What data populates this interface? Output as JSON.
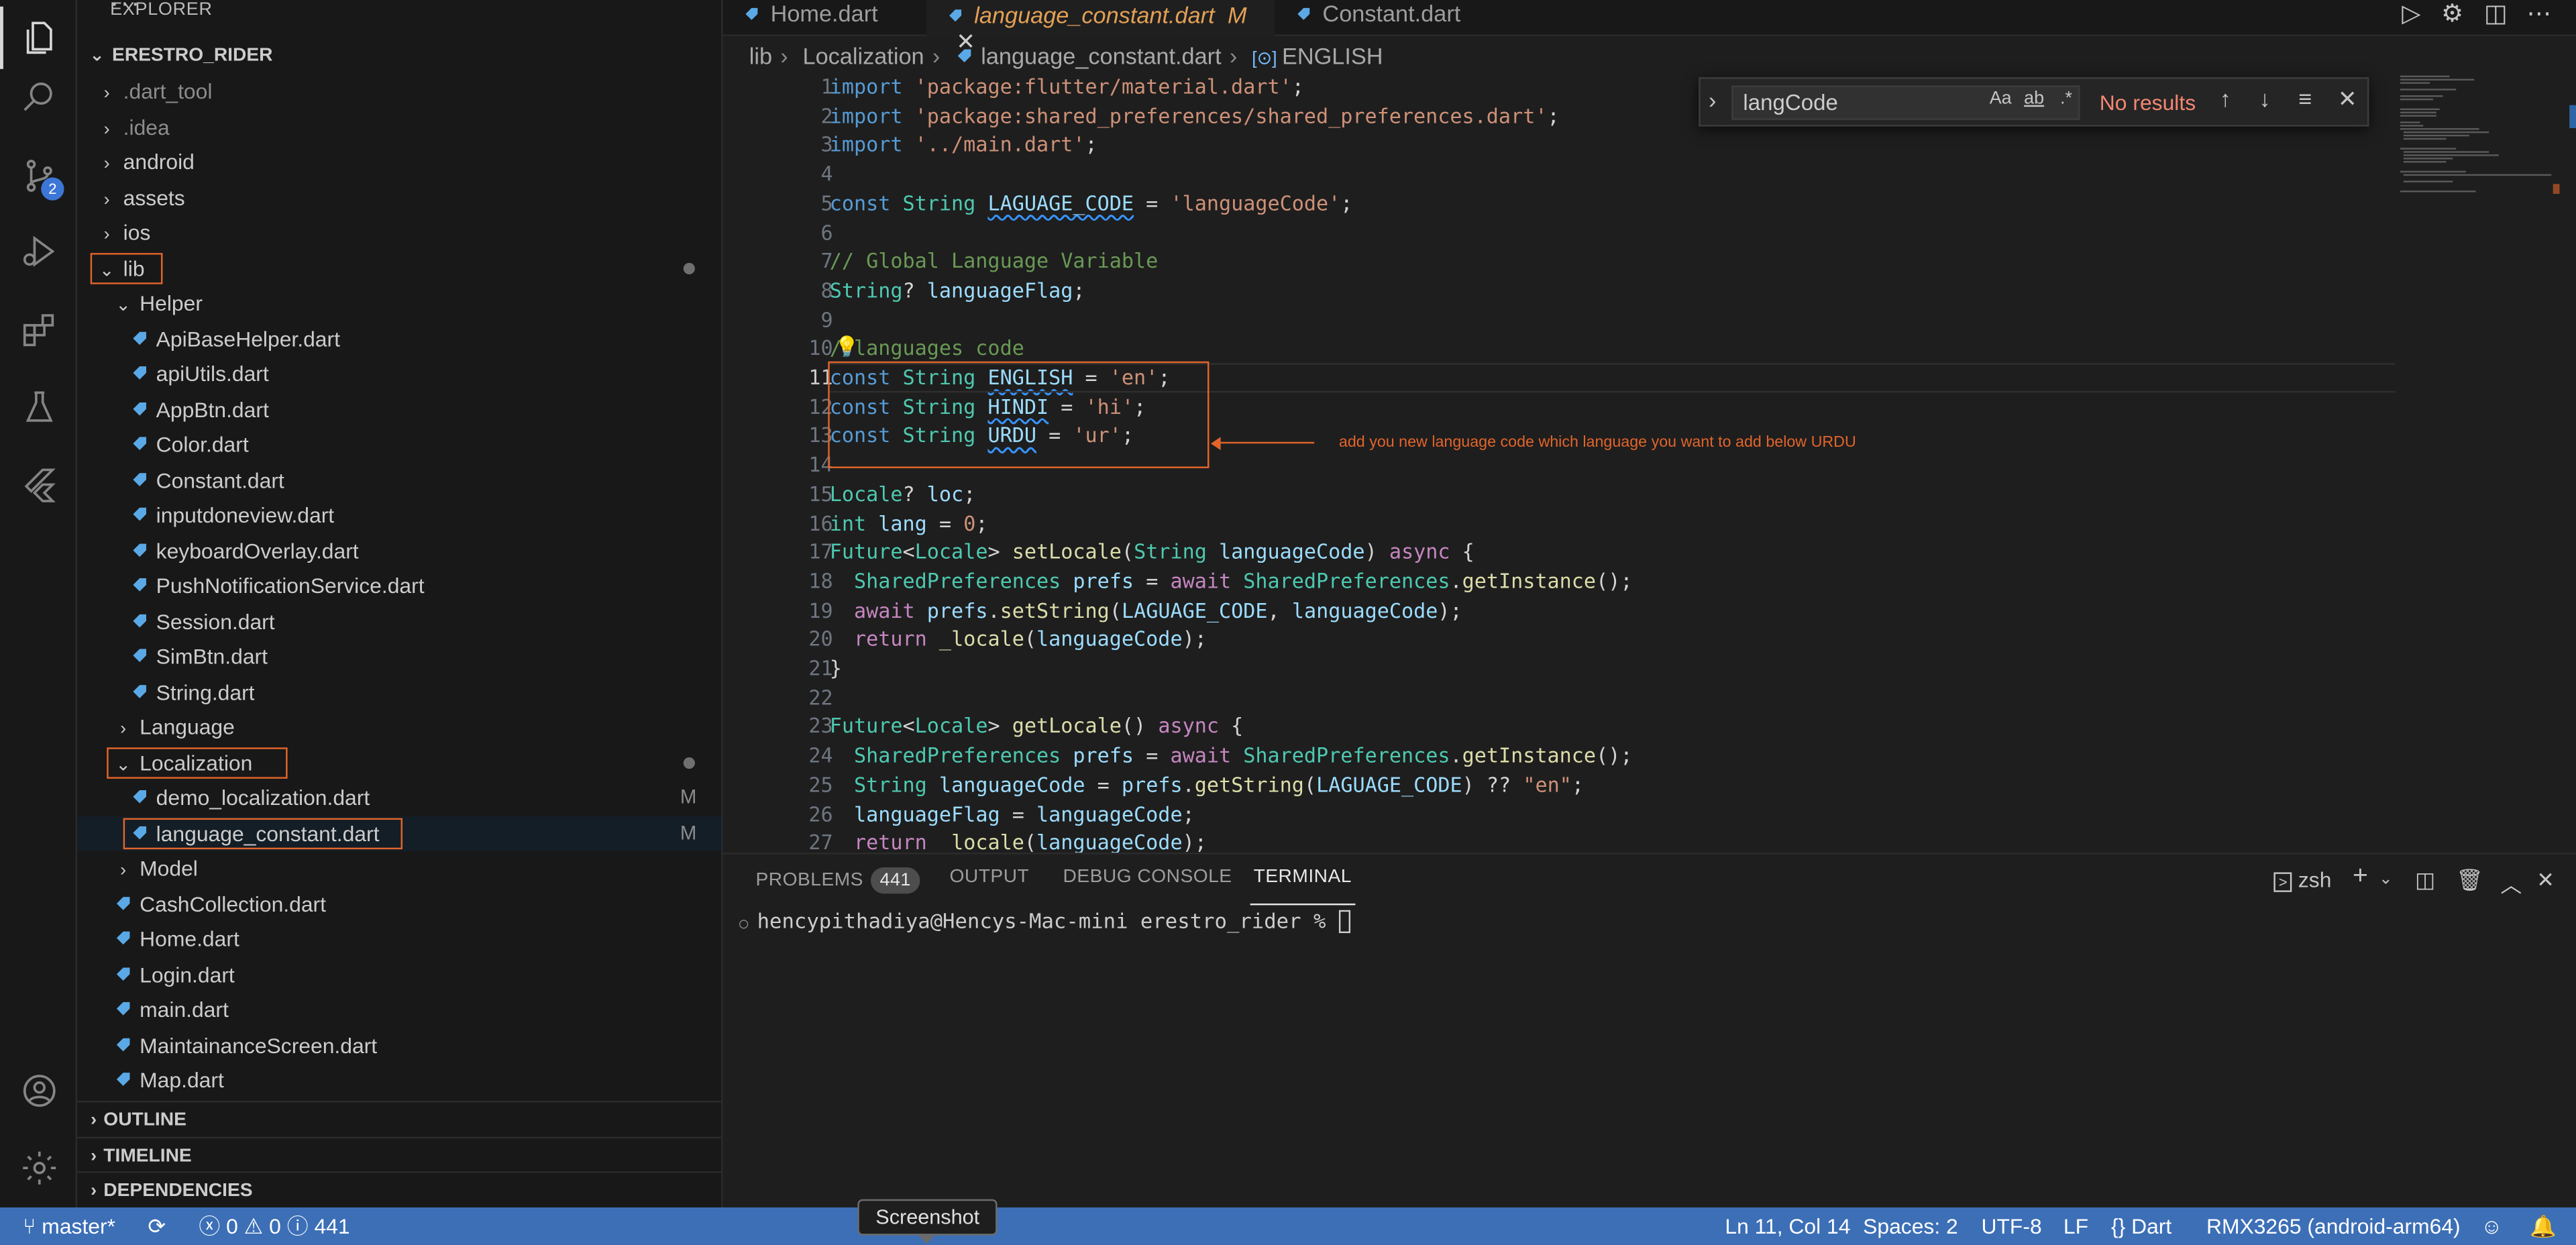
{
  "explorer": {
    "title": "EXPLORER",
    "root": "ERESTRO_RIDER",
    "items": [
      {
        "label": ".dart_tool",
        "kind": "folder",
        "depth": 1,
        "dim": true
      },
      {
        "label": ".idea",
        "kind": "folder",
        "depth": 1,
        "dim": true
      },
      {
        "label": "android",
        "kind": "folder",
        "depth": 1
      },
      {
        "label": "assets",
        "kind": "folder",
        "depth": 1
      },
      {
        "label": "ios",
        "kind": "folder",
        "depth": 1
      },
      {
        "label": "lib",
        "kind": "folder-open",
        "depth": 1,
        "dot": true,
        "boxed": true
      },
      {
        "label": "Helper",
        "kind": "folder-open",
        "depth": 2
      },
      {
        "label": "ApiBaseHelper.dart",
        "kind": "file",
        "depth": 3
      },
      {
        "label": "apiUtils.dart",
        "kind": "file",
        "depth": 3
      },
      {
        "label": "AppBtn.dart",
        "kind": "file",
        "depth": 3
      },
      {
        "label": "Color.dart",
        "kind": "file",
        "depth": 3
      },
      {
        "label": "Constant.dart",
        "kind": "file",
        "depth": 3
      },
      {
        "label": "inputdoneview.dart",
        "kind": "file",
        "depth": 3
      },
      {
        "label": "keyboardOverlay.dart",
        "kind": "file",
        "depth": 3
      },
      {
        "label": "PushNotificationService.dart",
        "kind": "file",
        "depth": 3
      },
      {
        "label": "Session.dart",
        "kind": "file",
        "depth": 3
      },
      {
        "label": "SimBtn.dart",
        "kind": "file",
        "depth": 3
      },
      {
        "label": "String.dart",
        "kind": "file",
        "depth": 3
      },
      {
        "label": "Language",
        "kind": "folder",
        "depth": 2
      },
      {
        "label": "Localization",
        "kind": "folder-open",
        "depth": 2,
        "dot": true,
        "boxed": true
      },
      {
        "label": "demo_localization.dart",
        "kind": "file",
        "depth": 3,
        "mod": "M"
      },
      {
        "label": "language_constant.dart",
        "kind": "file",
        "depth": 3,
        "mod": "M",
        "selected": true,
        "boxed": true
      },
      {
        "label": "Model",
        "kind": "folder",
        "depth": 2
      },
      {
        "label": "CashCollection.dart",
        "kind": "file",
        "depth": 2
      },
      {
        "label": "Home.dart",
        "kind": "file",
        "depth": 2
      },
      {
        "label": "Login.dart",
        "kind": "file",
        "depth": 2
      },
      {
        "label": "main.dart",
        "kind": "file",
        "depth": 2
      },
      {
        "label": "MaintainanceScreen.dart",
        "kind": "file",
        "depth": 2
      },
      {
        "label": "Map.dart",
        "kind": "file",
        "depth": 2
      }
    ],
    "sections": [
      "OUTLINE",
      "TIMELINE",
      "DEPENDENCIES"
    ]
  },
  "activity": {
    "scm_badge": "2"
  },
  "tabs": [
    {
      "label": "Home.dart",
      "modified": ""
    },
    {
      "label": "language_constant.dart",
      "modified": "M",
      "active": true
    },
    {
      "label": "Constant.dart",
      "modified": ""
    }
  ],
  "breadcrumb": [
    "lib",
    "Localization",
    "language_constant.dart",
    "ENGLISH"
  ],
  "find": {
    "query": "langCode",
    "result": "No results",
    "opt_case": "Aa",
    "opt_word": "ab",
    "opt_regex": ".*"
  },
  "editor": {
    "current_line": 11,
    "lines": [
      [
        [
          "kw",
          "import "
        ],
        [
          "st",
          "'package:flutter/material.dart'"
        ],
        [
          "pl",
          ";"
        ]
      ],
      [
        [
          "kw",
          "import "
        ],
        [
          "st",
          "'package:shared_preferences/shared_preferences.dart'"
        ],
        [
          "pl",
          ";"
        ]
      ],
      [
        [
          "kw",
          "import "
        ],
        [
          "st",
          "'../main.dart'"
        ],
        [
          "pl",
          ";"
        ]
      ],
      [],
      [
        [
          "kw",
          "const "
        ],
        [
          "ty",
          "String "
        ],
        [
          "squig",
          "LAGUAGE_CODE"
        ],
        [
          "pl",
          " = "
        ],
        [
          "st",
          "'languageCode'"
        ],
        [
          "pl",
          ";"
        ]
      ],
      [],
      [
        [
          "cm",
          "// Global Language Variable"
        ]
      ],
      [
        [
          "ty",
          "String"
        ],
        [
          "pl",
          "? "
        ],
        [
          "va",
          "languageFlag"
        ],
        [
          "pl",
          ";"
        ]
      ],
      [],
      [
        [
          "cm",
          "//languages code"
        ]
      ],
      [
        [
          "kw",
          "const "
        ],
        [
          "ty",
          "String "
        ],
        [
          "squig",
          "ENGLISH"
        ],
        [
          "pl",
          " = "
        ],
        [
          "st",
          "'en'"
        ],
        [
          "pl",
          ";"
        ]
      ],
      [
        [
          "kw",
          "const "
        ],
        [
          "ty",
          "String "
        ],
        [
          "squig",
          "HINDI"
        ],
        [
          "pl",
          " = "
        ],
        [
          "st",
          "'hi'"
        ],
        [
          "pl",
          ";"
        ]
      ],
      [
        [
          "kw",
          "const "
        ],
        [
          "ty",
          "String "
        ],
        [
          "squig",
          "URDU"
        ],
        [
          "pl",
          " = "
        ],
        [
          "st",
          "'ur'"
        ],
        [
          "pl",
          ";"
        ]
      ],
      [],
      [
        [
          "ty",
          "Locale"
        ],
        [
          "pl",
          "? "
        ],
        [
          "va",
          "loc"
        ],
        [
          "pl",
          ";"
        ]
      ],
      [
        [
          "ty",
          "int "
        ],
        [
          "va",
          "lang"
        ],
        [
          "pl",
          " = "
        ],
        [
          "st",
          "0"
        ],
        [
          "pl",
          ";"
        ]
      ],
      [
        [
          "ty",
          "Future"
        ],
        [
          "pl",
          "<"
        ],
        [
          "ty",
          "Locale"
        ],
        [
          "pl",
          "> "
        ],
        [
          "fn",
          "setLocale"
        ],
        [
          "pl",
          "("
        ],
        [
          "ty",
          "String "
        ],
        [
          "va",
          "languageCode"
        ],
        [
          "pl",
          ") "
        ],
        [
          "ct",
          "async"
        ],
        [
          "pl",
          " {"
        ]
      ],
      [
        [
          "pl",
          "  "
        ],
        [
          "ty",
          "SharedPreferences "
        ],
        [
          "va",
          "prefs"
        ],
        [
          "pl",
          " = "
        ],
        [
          "ct",
          "await "
        ],
        [
          "ty",
          "SharedPreferences"
        ],
        [
          "pl",
          "."
        ],
        [
          "fn",
          "getInstance"
        ],
        [
          "pl",
          "();"
        ]
      ],
      [
        [
          "pl",
          "  "
        ],
        [
          "ct",
          "await "
        ],
        [
          "va",
          "prefs"
        ],
        [
          "pl",
          "."
        ],
        [
          "fn",
          "setString"
        ],
        [
          "pl",
          "("
        ],
        [
          "va",
          "LAGUAGE_CODE"
        ],
        [
          "pl",
          ", "
        ],
        [
          "va",
          "languageCode"
        ],
        [
          "pl",
          ");"
        ]
      ],
      [
        [
          "pl",
          "  "
        ],
        [
          "ct",
          "return "
        ],
        [
          "fn",
          "_locale"
        ],
        [
          "pl",
          "("
        ],
        [
          "va",
          "languageCode"
        ],
        [
          "pl",
          ");"
        ]
      ],
      [
        [
          "pl",
          "}"
        ]
      ],
      [],
      [
        [
          "ty",
          "Future"
        ],
        [
          "pl",
          "<"
        ],
        [
          "ty",
          "Locale"
        ],
        [
          "pl",
          "> "
        ],
        [
          "fn",
          "getLocale"
        ],
        [
          "pl",
          "() "
        ],
        [
          "ct",
          "async"
        ],
        [
          "pl",
          " {"
        ]
      ],
      [
        [
          "pl",
          "  "
        ],
        [
          "ty",
          "SharedPreferences "
        ],
        [
          "va",
          "prefs"
        ],
        [
          "pl",
          " = "
        ],
        [
          "ct",
          "await "
        ],
        [
          "ty",
          "SharedPreferences"
        ],
        [
          "pl",
          "."
        ],
        [
          "fn",
          "getInstance"
        ],
        [
          "pl",
          "();"
        ]
      ],
      [
        [
          "pl",
          "  "
        ],
        [
          "ty",
          "String "
        ],
        [
          "va",
          "languageCode"
        ],
        [
          "pl",
          " = "
        ],
        [
          "va",
          "prefs"
        ],
        [
          "pl",
          "."
        ],
        [
          "fn",
          "getString"
        ],
        [
          "pl",
          "("
        ],
        [
          "va",
          "LAGUAGE_CODE"
        ],
        [
          "pl",
          ") ?? "
        ],
        [
          "st",
          "\"en\""
        ],
        [
          "pl",
          ";"
        ]
      ],
      [
        [
          "pl",
          "  "
        ],
        [
          "va",
          "languageFlag"
        ],
        [
          "pl",
          " = "
        ],
        [
          "va",
          "languageCode"
        ],
        [
          "pl",
          ";"
        ]
      ],
      [
        [
          "pl",
          "  "
        ],
        [
          "ct",
          "return "
        ],
        [
          "fn",
          "_locale"
        ],
        [
          "pl",
          "("
        ],
        [
          "va",
          "languageCode"
        ],
        [
          "pl",
          ");"
        ]
      ]
    ],
    "annotation": "add you new language code which language you want to add below URDU"
  },
  "panel": {
    "tabs": [
      {
        "label": "PROBLEMS",
        "badge": "441"
      },
      {
        "label": "OUTPUT"
      },
      {
        "label": "DEBUG CONSOLE"
      },
      {
        "label": "TERMINAL",
        "active": true
      }
    ],
    "shell": "zsh",
    "prompt": "hencypithadiya@Hencys-Mac-mini erestro_rider % "
  },
  "status": {
    "branch": "master*",
    "errors": "0",
    "warnings": "0",
    "info": "441",
    "position": "Ln 11, Col 14",
    "spaces": "Spaces: 2",
    "encoding": "UTF-8",
    "eol": "LF",
    "language": "Dart",
    "device": "RMX3265 (android-arm64)",
    "tooltip": "Screenshot"
  },
  "colors": {
    "accent": "#0078d4",
    "status_bar": "#3c6fb6",
    "highlight": "#e2642b"
  }
}
